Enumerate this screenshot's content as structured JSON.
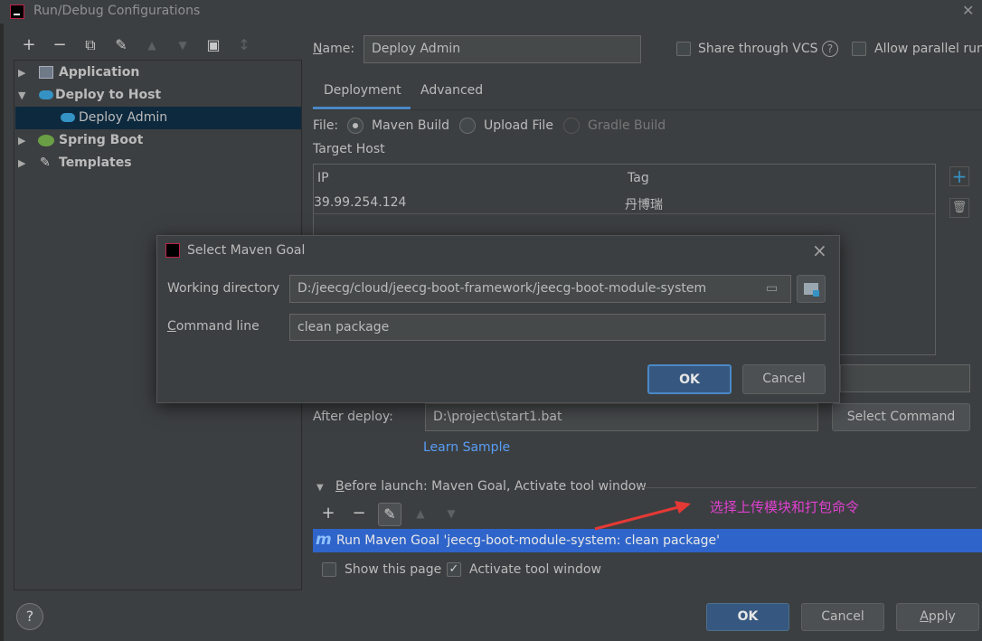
{
  "window": {
    "title": "Run/Debug Configurations"
  },
  "toolbar": {
    "add": "+",
    "remove": "−",
    "copy": "⧉",
    "edit": "✎",
    "up": "▲",
    "down": "▼",
    "folder": "▣",
    "sort": "↕"
  },
  "tree": {
    "items": [
      {
        "label": "Application",
        "expanded": false
      },
      {
        "label": "Deploy to Host",
        "expanded": true
      },
      {
        "label": "Deploy Admin",
        "selected": true
      },
      {
        "label": "Spring Boot",
        "expanded": false
      },
      {
        "label": "Templates",
        "expanded": false
      }
    ]
  },
  "form": {
    "name_label": "Name:",
    "name_value": "Deploy Admin",
    "share_vcs": "Share through VCS",
    "allow_parallel": "Allow parallel run",
    "help": "?"
  },
  "tabs": [
    {
      "label": "Deployment",
      "active": true
    },
    {
      "label": "Advanced",
      "active": false
    }
  ],
  "deployment": {
    "file_label": "File:",
    "file_options": [
      "Maven Build",
      "Upload File",
      "Gradle Build"
    ],
    "target_host_label": "Target Host",
    "table": {
      "headers": [
        "IP",
        "Tag"
      ],
      "rows": [
        [
          "39.99.254.124",
          "丹博瑞"
        ]
      ]
    },
    "add_host": "+",
    "delete_host": "🗑",
    "after_deploy_label": "After deploy:",
    "after_deploy_value": "D:\\project\\start1.bat",
    "select_command": "Select Command",
    "learn_sample": "Learn Sample"
  },
  "before_launch": {
    "label": "Before launch: Maven Goal, Activate tool window",
    "add": "+",
    "remove": "−",
    "edit": "✎",
    "up": "▲",
    "down": "▼",
    "task_icon": "m",
    "task": "Run Maven Goal 'jeecg-boot-module-system: clean package'",
    "show_page": "Show this page",
    "activate_tool_window": "Activate tool window"
  },
  "annotation": {
    "text": "选择上传模块和打包命令",
    "color": "#e040d0",
    "arrow_color": "#e53935"
  },
  "footer": {
    "help": "?",
    "ok": "OK",
    "cancel": "Cancel",
    "apply": "Apply"
  },
  "modal": {
    "title": "Select Maven Goal",
    "close": "×",
    "working_dir_label": "Working directory",
    "working_dir_value": "D:/jeecg/cloud/jeecg-boot-framework/jeecg-boot-module-system",
    "command_line_label": "Command line",
    "command_line_value": "clean package",
    "ok": "OK",
    "cancel": "Cancel"
  }
}
